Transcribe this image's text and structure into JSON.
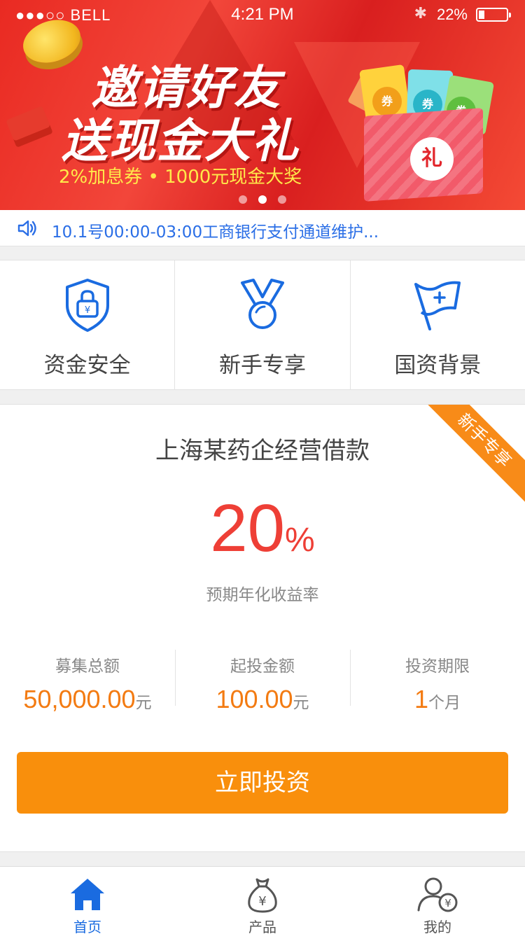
{
  "status_bar": {
    "signal": "●●●○○ BELL",
    "time": "4:21 PM",
    "battery_percent": "22%",
    "battery_level": 0.22
  },
  "banner": {
    "title_line1": "邀请好友",
    "title_line2": "送现金大礼",
    "subtitle": "2%加息券 • 1000元现金大奖",
    "gift_badge": "礼",
    "coupon_label": "券",
    "slide_count": 3,
    "active_slide": 1
  },
  "notice": {
    "text": "10.1号00:00-03:00工商银行支付通道维护..."
  },
  "features": [
    {
      "label": "资金安全",
      "icon": "shield-lock-icon"
    },
    {
      "label": "新手专享",
      "icon": "medal-icon"
    },
    {
      "label": "国资背景",
      "icon": "flag-icon"
    }
  ],
  "product": {
    "ribbon": "新手专享",
    "title": "上海某药企经营借款",
    "rate_value": "20",
    "rate_unit": "%",
    "rate_label": "预期年化收益率",
    "stats": [
      {
        "label": "募集总额",
        "value": "50,000.00",
        "unit": "元"
      },
      {
        "label": "起投金额",
        "value": "100.00",
        "unit": "元"
      },
      {
        "label": "投资期限",
        "value": "1",
        "unit": "个月"
      }
    ],
    "button": "立即投资"
  },
  "tabbar": [
    {
      "label": "首页",
      "icon": "home-icon",
      "active": true
    },
    {
      "label": "产品",
      "icon": "money-bag-icon",
      "active": false
    },
    {
      "label": "我的",
      "icon": "user-icon",
      "active": false
    }
  ],
  "colors": {
    "accent_blue": "#1a6be0",
    "rate_red": "#ee3f36",
    "orange": "#f98f0c",
    "banner_red": "#e92a22"
  }
}
